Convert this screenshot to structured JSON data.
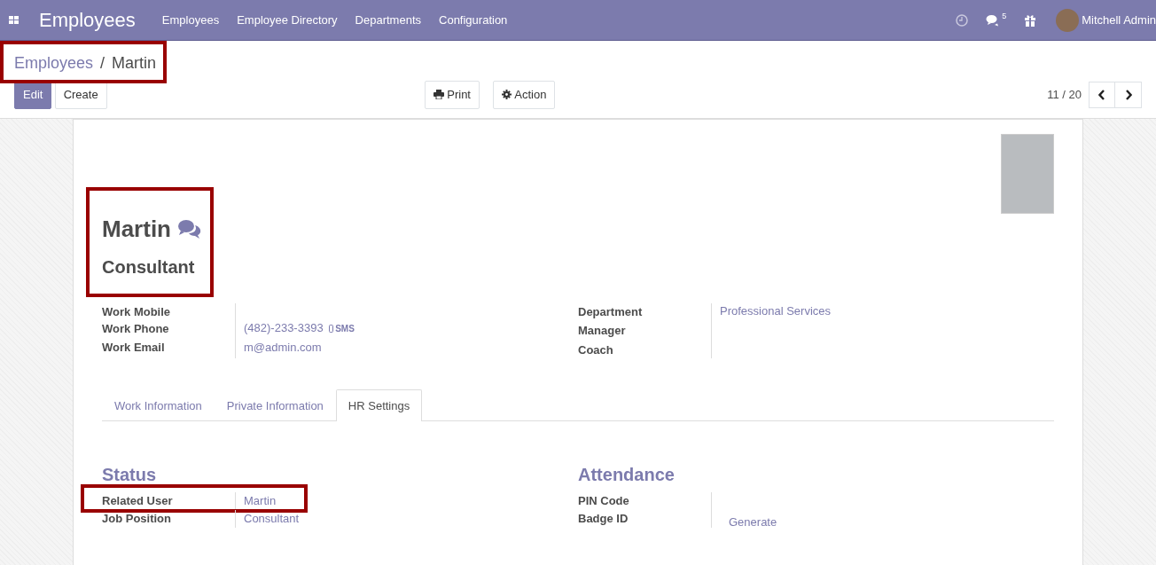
{
  "navbar": {
    "app_title": "Employees",
    "menu": [
      "Employees",
      "Employee Directory",
      "Departments",
      "Configuration"
    ],
    "messages_count": "5",
    "user": "Mitchell Admin"
  },
  "breadcrumb": {
    "parent": "Employees",
    "separator": "/",
    "current": "Martin",
    "highlighted": true
  },
  "left_buttons": [
    {
      "label": "Edit",
      "primary": true
    },
    {
      "label": "Create",
      "primary": false
    }
  ],
  "center_buttons": [
    {
      "label": "Print",
      "kind": "print"
    },
    {
      "label": "Action",
      "kind": "action"
    }
  ],
  "pager": "11 / 20",
  "employee": {
    "name": "Martin",
    "job_title": "Consultant",
    "highlighted": true
  },
  "contact_fields": [
    {
      "label": "Work Mobile"
    },
    {
      "label": "Work Phone",
      "value": "(482)-233-3393",
      "sms": "SMS"
    },
    {
      "label": "Work Email",
      "value": "m@admin.com"
    }
  ],
  "org_fields": [
    {
      "label": "Department",
      "value": "Professional Services"
    },
    {
      "label": "Manager"
    },
    {
      "label": "Coach"
    }
  ],
  "tabs": [
    {
      "label": "Work Information",
      "selected": false
    },
    {
      "label": "Private Information",
      "selected": false
    },
    {
      "label": "HR Settings",
      "selected": true
    }
  ],
  "hr_sections": [
    {
      "title": "Status",
      "fields": [
        {
          "label": "Related User",
          "value": "Martin",
          "highlighted": true
        },
        {
          "label": "Job Position",
          "value": "Consultant",
          "highlighted": false
        }
      ]
    },
    {
      "title": "Attendance",
      "fields": [
        {
          "label": "PIN Code",
          "highlighted": false
        },
        {
          "label": "Badge ID",
          "action": "Generate",
          "highlighted": false
        }
      ]
    }
  ]
}
